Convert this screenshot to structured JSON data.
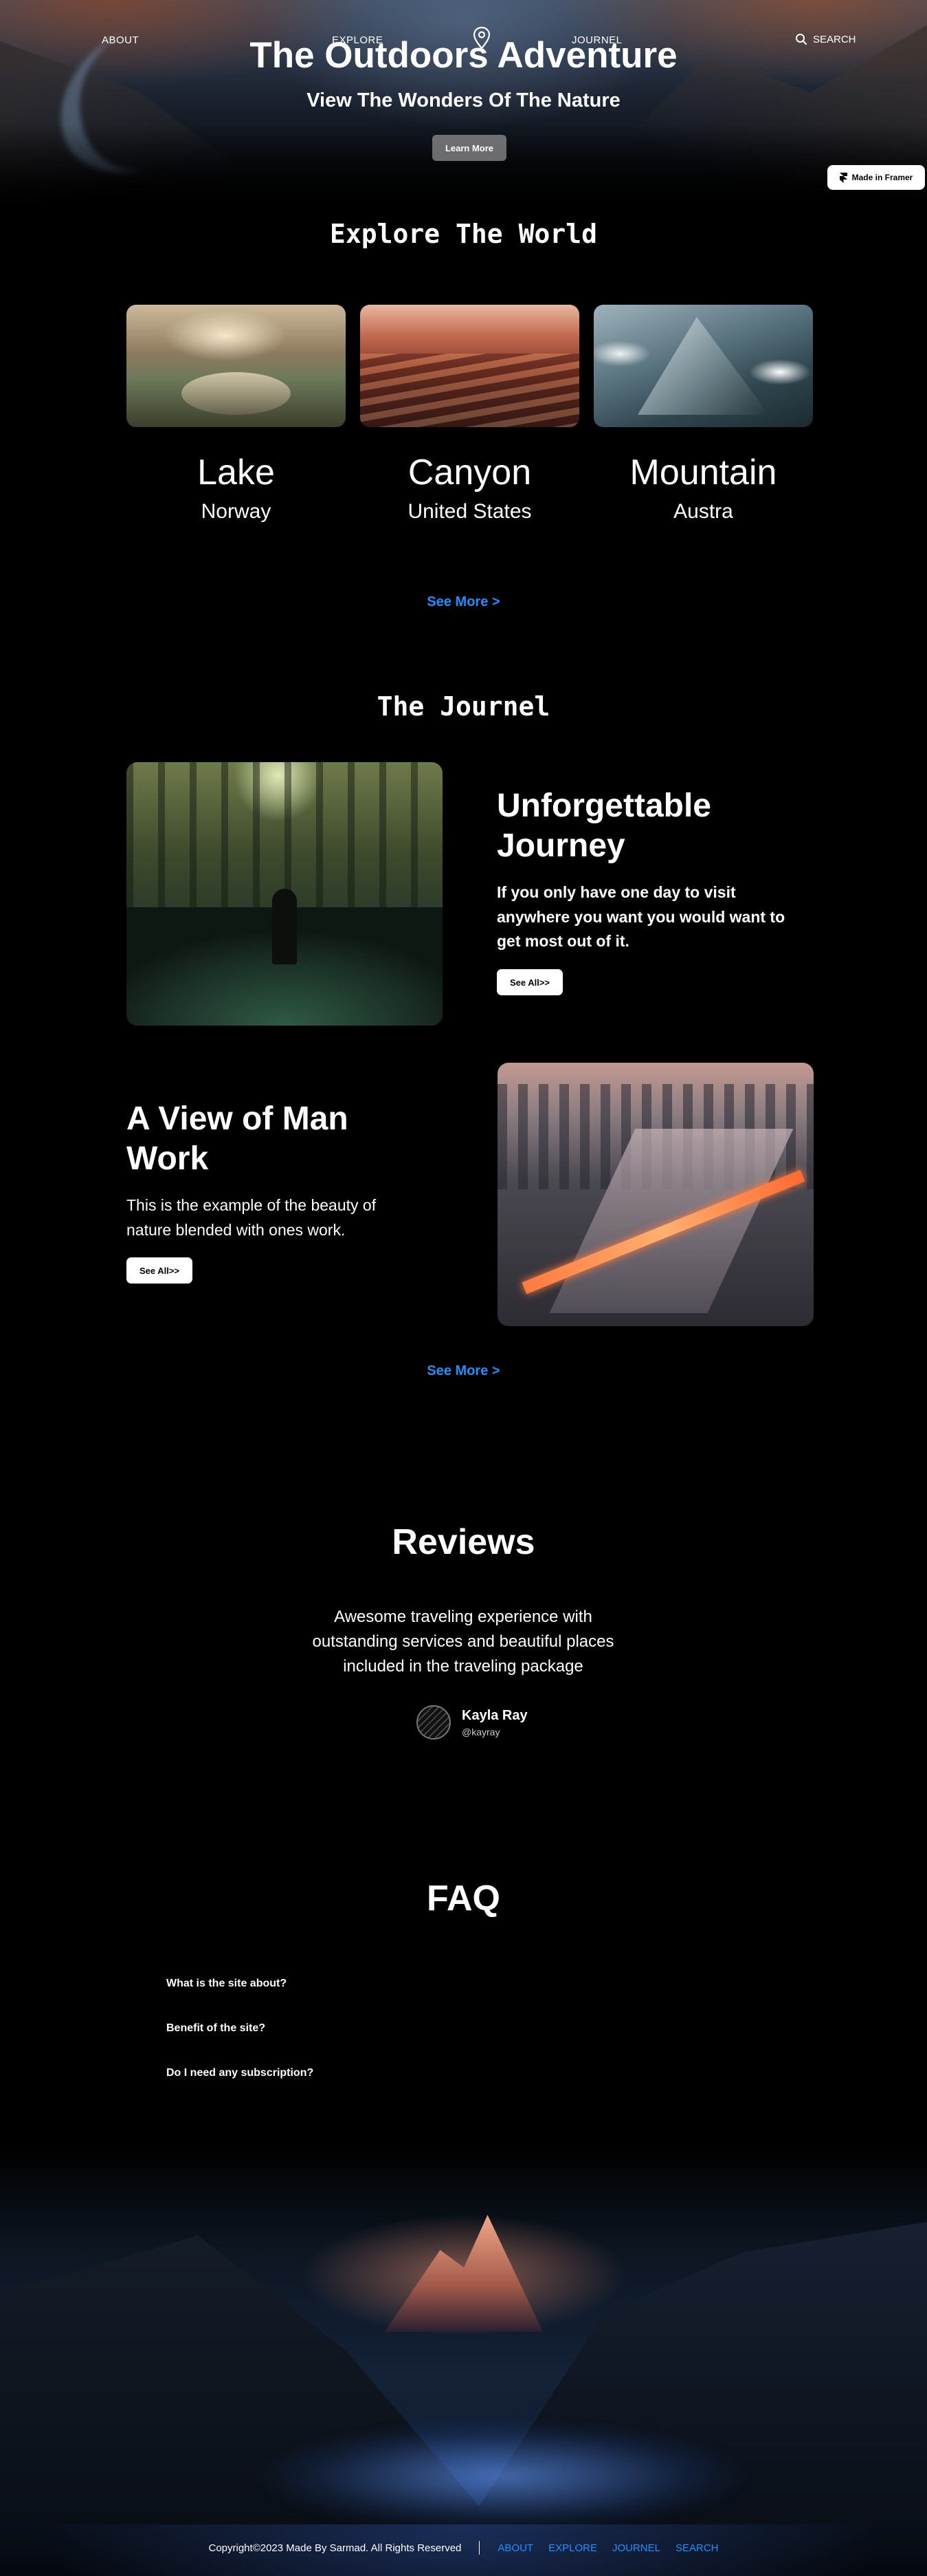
{
  "nav": {
    "about": "ABOUT",
    "explore": "EXPLORE",
    "journel": "JOURNEL",
    "search": "SEARCH"
  },
  "hero": {
    "title": "The Outdoors Adventure",
    "subtitle": "View The Wonders Of The Nature",
    "cta": "Learn More"
  },
  "badge": {
    "label": "Made in Framer"
  },
  "explore": {
    "title": "Explore The World",
    "cards": [
      {
        "name": "Lake",
        "location": "Norway"
      },
      {
        "name": "Canyon",
        "location": "United States"
      },
      {
        "name": "Mountain",
        "location": "Austra"
      }
    ],
    "see_more": "See More >"
  },
  "journel": {
    "title": "The Journel",
    "entries": [
      {
        "heading": "Unforgettable Journey",
        "text": "If you only have one day to visit anywhere you want you would want to get most out of it.",
        "button": "See All>>"
      },
      {
        "heading": "A View of Man Work",
        "text": "This is the example of the beauty of nature blended with ones work.",
        "button": "See All>>"
      }
    ],
    "see_more": "See More >"
  },
  "reviews": {
    "title": "Reviews",
    "quote": "Awesome traveling experience  with outstanding services and beautiful places included in the traveling package",
    "reviewer_name": "Kayla Ray",
    "reviewer_handle": "@kayray"
  },
  "faq": {
    "title": "FAQ",
    "items": [
      "What is the site about?",
      "Benefit of the site?",
      "Do I need any subscription?"
    ]
  },
  "footer": {
    "copyright": "Copyright©2023 Made By Sarmad. All Rights Reserved",
    "links": [
      "ABOUT",
      "EXPLORE",
      "JOURNEL",
      "SEARCH"
    ]
  },
  "colors": {
    "accent_link": "#1e90ff",
    "background": "#000000",
    "button_bg": "#ffffff"
  },
  "icons": {
    "search": "search-icon",
    "location": "location-pin-icon",
    "framer": "framer-logo-icon"
  }
}
